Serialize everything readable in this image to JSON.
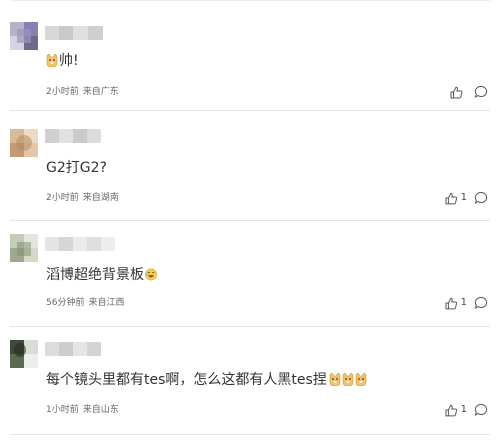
{
  "comments": [
    {
      "text": "帅!",
      "emoji": [
        "doge"
      ],
      "time": "2小时前",
      "location": "来自广东",
      "likes": ""
    },
    {
      "text": "G2打G2?",
      "emoji": [],
      "time": "2小时前",
      "location": "来自湖南",
      "likes": "1"
    },
    {
      "text": "滔博超绝背景板",
      "emoji": [
        "laugh"
      ],
      "time": "56分钟前",
      "location": "来自江西",
      "likes": "1"
    },
    {
      "text": "每个镜头里都有tes啊，怎么这都有人黑tes捏",
      "emoji": [
        "doge",
        "doge",
        "doge"
      ],
      "time": "1小时前",
      "location": "来自山东",
      "likes": "1"
    }
  ],
  "icons": {
    "like": "thumbs-up-icon",
    "reply": "comment-bubble-icon",
    "emoji_doge": "doge-emoji",
    "emoji_laugh": "laughing-emoji"
  },
  "colors": {
    "text": "#333333",
    "meta": "#666666",
    "separator": "#e6e6e6"
  }
}
